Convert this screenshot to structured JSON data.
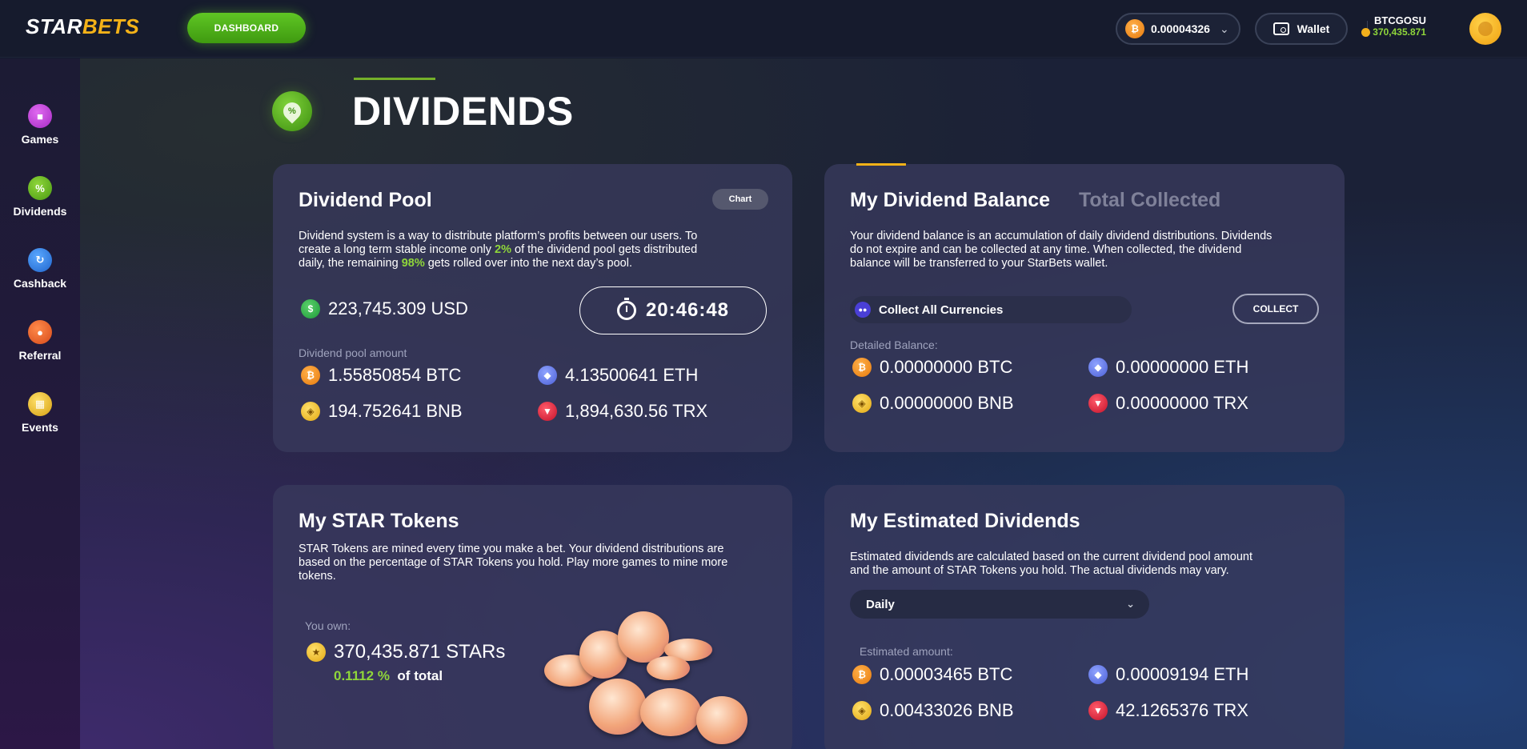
{
  "header": {
    "logo_part1": "STAR",
    "logo_part2": "BETS",
    "dashboard_label": "DASHBOARD",
    "balance_value": "0.00004326",
    "balance_chevron": "⌄",
    "wallet_label": "Wallet",
    "username": "BTCGOSU",
    "user_points": "370,435.871"
  },
  "sidebar": {
    "items": [
      {
        "label": "Games",
        "icon": "gamepad-icon",
        "color": "#c43ad6"
      },
      {
        "label": "Dividends",
        "icon": "dividends-icon",
        "color": "#5cae1e"
      },
      {
        "label": "Cashback",
        "icon": "cashback-icon",
        "color": "#2d7fe0"
      },
      {
        "label": "Referral",
        "icon": "referral-icon",
        "color": "#e8602a"
      },
      {
        "label": "Events",
        "icon": "events-icon",
        "color": "#e2b412"
      }
    ]
  },
  "page": {
    "title": "DIVIDENDS",
    "title_icon_symbol": "%"
  },
  "dividend_pool": {
    "title": "Dividend Pool",
    "chart_label": "Chart",
    "desc_1": "Dividend system is a way to distribute platform’s profits between our users. To",
    "desc_2a": "create a long term stable income only ",
    "desc_2b": "2%",
    "desc_2c": " of the dividend pool gets distributed",
    "desc_3a": "daily, the remaining ",
    "desc_3b": "98%",
    "desc_3c": " gets rolled over into the next day’s pool.",
    "usd_value": "223,745.309 USD",
    "timer": "20:46:48",
    "amount_label": "Dividend pool amount",
    "btc": "1.55850854 BTC",
    "eth": "4.13500641 ETH",
    "bnb": "194.752641 BNB",
    "trx": "1,894,630.56 TRX"
  },
  "my_balance": {
    "tab_active": "My Dividend Balance",
    "tab_inactive": "Total Collected",
    "desc_1": "Your dividend balance is an accumulation of daily dividend distributions. Dividends",
    "desc_2": "do not expire and can be collected at any time. When collected, the dividend",
    "desc_3": "balance will be transferred to your StarBets wallet.",
    "collect_select": "Collect All Currencies",
    "collect_button": "COLLECT",
    "detailed_label": "Detailed Balance:",
    "btc": "0.00000000 BTC",
    "eth": "0.00000000 ETH",
    "bnb": "0.00000000 BNB",
    "trx": "0.00000000 TRX"
  },
  "star_tokens": {
    "title": "My STAR Tokens",
    "desc_1": "STAR Tokens are mined every time you make a bet. Your dividend distributions are",
    "desc_2": "based on the percentage of STAR Tokens you hold. Play more games to mine more",
    "desc_3": "tokens.",
    "you_own_label": "You own:",
    "amount": "370,435.871 STARs",
    "percent": "0.1112 %",
    "of_total": "of total"
  },
  "estimated": {
    "title": "My Estimated Dividends",
    "desc_1": "Estimated dividends are calculated based on the current dividend pool amount",
    "desc_2": "and the amount of STAR Tokens you hold. The actual dividends may vary.",
    "period": "Daily",
    "period_chevron": "⌄",
    "amount_label": "Estimated amount:",
    "btc": "0.00003465 BTC",
    "eth": "0.00009194 ETH",
    "bnb": "0.00433026 BNB",
    "trx": "42.1265376 TRX"
  },
  "coin_symbols": {
    "btc": "₿",
    "eth": "◆",
    "bnb": "◈",
    "trx": "▼",
    "usd": "$",
    "star": "★"
  }
}
